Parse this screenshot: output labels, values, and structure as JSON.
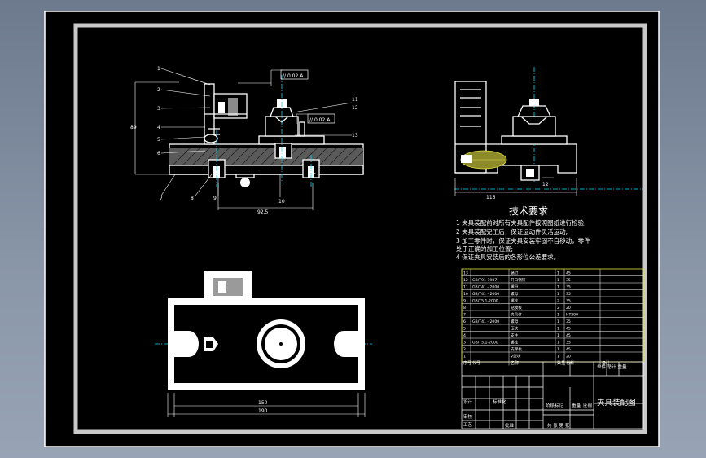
{
  "drawing": {
    "title": "夹具装配图",
    "tech_requirements": {
      "heading": "技术要求",
      "items": [
        "1  夹具装配前对所有夹具配件按照图纸进行检验;",
        "2  夹具装配完工后，保证运动件灵活运动;",
        "3  加工零件时，保证夹具安装牢固不自移动，零件",
        "    处于正确的加工位置;",
        "4  保证夹具安装后的各形位公差要求。"
      ]
    },
    "front_view": {
      "part_numbers": [
        "1",
        "2",
        "3",
        "4",
        "5",
        "6",
        "7",
        "8",
        "9",
        "10",
        "11",
        "12",
        "13"
      ],
      "dims": {
        "height": "89",
        "length": "92.5"
      },
      "tolerance_frames": [
        "// 0.02 A",
        "// 0.02 A"
      ]
    },
    "side_view": {
      "dims": {
        "width": "116",
        "height": "12"
      }
    },
    "top_view": {
      "dims": {
        "inner": "150",
        "outer": "190"
      }
    },
    "bom": {
      "rows": [
        {
          "no": "13",
          "code": "",
          "name": "销钉",
          "qty": "1",
          "mat": "45"
        },
        {
          "no": "12",
          "code": "GB/T91-1987",
          "name": "开口销钉",
          "qty": "1",
          "mat": "35"
        },
        {
          "no": "11",
          "code": "GB/T41 - 2000",
          "name": "螺母",
          "qty": "1",
          "mat": "35"
        },
        {
          "no": "10",
          "code": "GB/T41 - 2000",
          "name": "螺母",
          "qty": "1",
          "mat": "35"
        },
        {
          "no": "9",
          "code": "GB/T5.1-2000",
          "name": "螺栓",
          "qty": "2",
          "mat": "35"
        },
        {
          "no": "8",
          "code": "",
          "name": "钻模板",
          "qty": "2",
          "mat": "20"
        },
        {
          "no": "7",
          "code": "",
          "name": "夹具体",
          "qty": "1",
          "mat": "HT200"
        },
        {
          "no": "6",
          "code": "GB/T41 - 2000",
          "name": "螺母",
          "qty": "1",
          "mat": "35"
        },
        {
          "no": "5",
          "code": "",
          "name": "压块",
          "qty": "1",
          "mat": "45"
        },
        {
          "no": "4",
          "code": "",
          "name": "支柱",
          "qty": "1",
          "mat": "45"
        },
        {
          "no": "3",
          "code": "GB/T5.1-2000",
          "name": "螺栓",
          "qty": "1",
          "mat": "35"
        },
        {
          "no": "2",
          "code": "",
          "name": "支撑板",
          "qty": "1",
          "mat": "45"
        },
        {
          "no": "1",
          "code": "",
          "name": "V型块",
          "qty": "1",
          "mat": "20"
        }
      ],
      "header": [
        "序号",
        "代号",
        "名称",
        "数量",
        "材料",
        "备注"
      ],
      "header_note": "单件 总计 重量",
      "title_labels": {
        "designer": "设计",
        "standard": "标准化",
        "review": "审核",
        "process": "工艺",
        "approve": "批准",
        "stage": "阶段标记",
        "weight": "重量",
        "scale": "比例",
        "sheet": "共  张  第  张"
      }
    }
  }
}
